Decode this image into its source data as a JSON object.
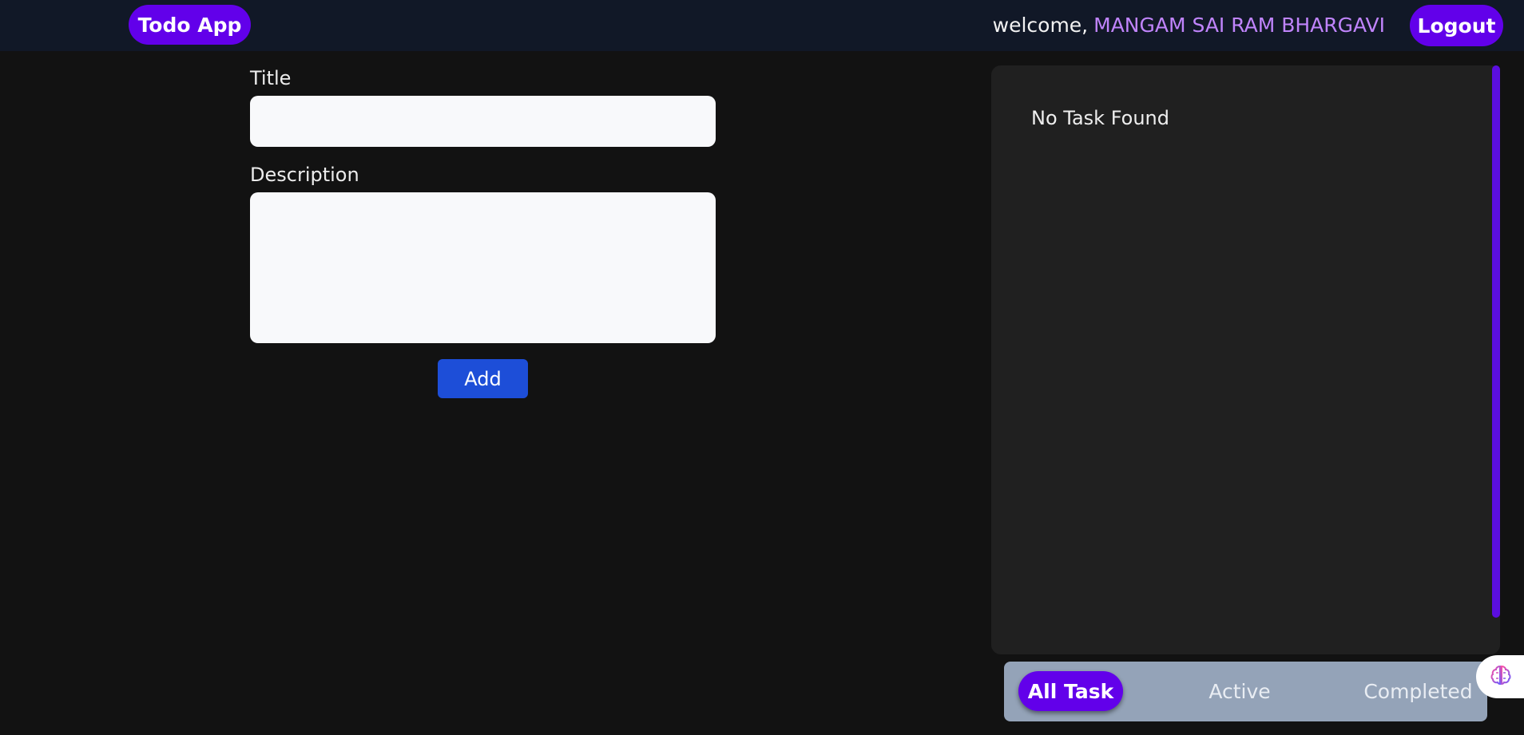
{
  "header": {
    "brand": "Todo App",
    "welcome_label": "welcome,",
    "user_name": "MANGAM SAI RAM BHARGAVI",
    "logout_label": "Logout"
  },
  "form": {
    "title_label": "Title",
    "title_value": "",
    "description_label": "Description",
    "description_value": "",
    "add_label": "Add"
  },
  "tasks": {
    "empty_message": "No Task Found"
  },
  "filters": {
    "all": "All Task",
    "active": "Active",
    "completed": "Completed",
    "selected": "All Task"
  },
  "widgets": {
    "assistant_icon": "brain-icon"
  },
  "colors": {
    "accent": "#6200ea",
    "add_button": "#1d4ed8",
    "user_name": "#c084fc",
    "filter_bar": "#94a3b8"
  }
}
